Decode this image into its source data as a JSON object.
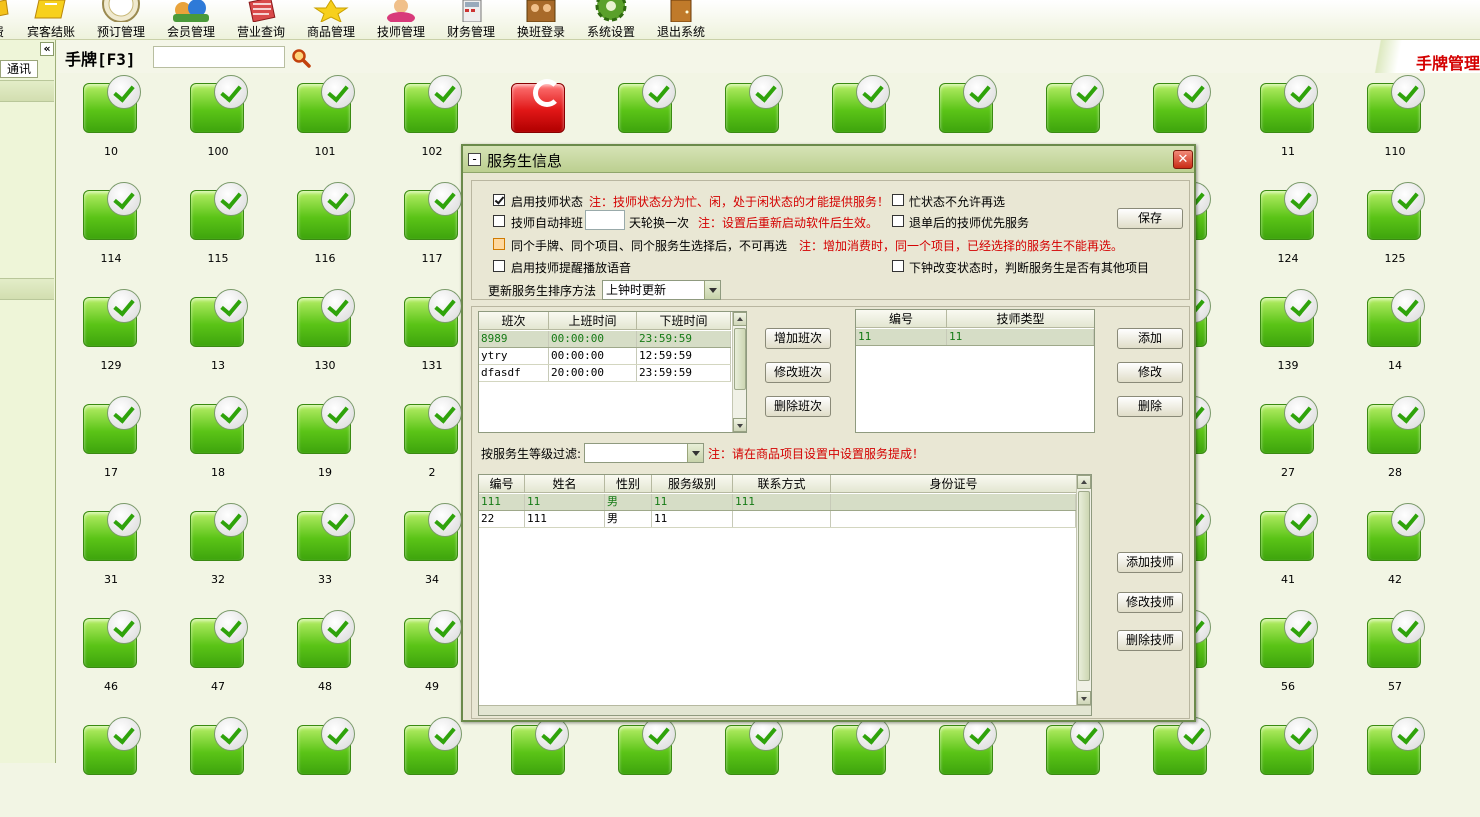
{
  "toolbar": {
    "items": [
      {
        "label": "费",
        "icon": "yellow-cut-icon"
      },
      {
        "label": "宾客结账",
        "icon": "checkout-icon"
      },
      {
        "label": "预订管理",
        "icon": "booking-clock-icon"
      },
      {
        "label": "会员管理",
        "icon": "members-icon"
      },
      {
        "label": "营业查询",
        "icon": "business-query-icon"
      },
      {
        "label": "商品管理",
        "icon": "star-goods-icon"
      },
      {
        "label": "技师管理",
        "icon": "technician-icon"
      },
      {
        "label": "财务管理",
        "icon": "finance-icon"
      },
      {
        "label": "换班登录",
        "icon": "shift-login-icon"
      },
      {
        "label": "系统设置",
        "icon": "gear-icon"
      },
      {
        "label": "退出系统",
        "icon": "exit-door-icon"
      }
    ]
  },
  "left_panel": {
    "collapse_label": "«",
    "tab_label": "通讯"
  },
  "header": {
    "title": "手牌[F3]",
    "search_value": "",
    "right_title": "手牌管理"
  },
  "tiles": [
    {
      "label": "10",
      "status": "free"
    },
    {
      "label": "100",
      "status": "free"
    },
    {
      "label": "101",
      "status": "free"
    },
    {
      "label": "102",
      "status": "free"
    },
    {
      "label": "",
      "status": "busy"
    },
    {
      "label": "",
      "status": "free"
    },
    {
      "label": "",
      "status": "free"
    },
    {
      "label": "",
      "status": "free"
    },
    {
      "label": "",
      "status": "free"
    },
    {
      "label": "",
      "status": "free"
    },
    {
      "label": "",
      "status": "free"
    },
    {
      "label": "11",
      "status": "free"
    },
    {
      "label": "110",
      "status": "free"
    },
    {
      "label": "114",
      "status": "free"
    },
    {
      "label": "115",
      "status": "free"
    },
    {
      "label": "116",
      "status": "free"
    },
    {
      "label": "117",
      "status": "free"
    },
    {
      "label": "",
      "status": "free"
    },
    {
      "label": "",
      "status": "free"
    },
    {
      "label": "",
      "status": "free"
    },
    {
      "label": "",
      "status": "free"
    },
    {
      "label": "",
      "status": "free"
    },
    {
      "label": "",
      "status": "free"
    },
    {
      "label": "",
      "status": "free"
    },
    {
      "label": "124",
      "status": "free"
    },
    {
      "label": "125",
      "status": "free"
    },
    {
      "label": "129",
      "status": "free"
    },
    {
      "label": "13",
      "status": "free"
    },
    {
      "label": "130",
      "status": "free"
    },
    {
      "label": "131",
      "status": "free"
    },
    {
      "label": "",
      "status": "free"
    },
    {
      "label": "",
      "status": "free"
    },
    {
      "label": "",
      "status": "free"
    },
    {
      "label": "",
      "status": "free"
    },
    {
      "label": "",
      "status": "free"
    },
    {
      "label": "",
      "status": "free"
    },
    {
      "label": "",
      "status": "free"
    },
    {
      "label": "139",
      "status": "free"
    },
    {
      "label": "14",
      "status": "free"
    },
    {
      "label": "17",
      "status": "free"
    },
    {
      "label": "18",
      "status": "free"
    },
    {
      "label": "19",
      "status": "free"
    },
    {
      "label": "2",
      "status": "free"
    },
    {
      "label": "",
      "status": "free"
    },
    {
      "label": "",
      "status": "free"
    },
    {
      "label": "",
      "status": "free"
    },
    {
      "label": "",
      "status": "free"
    },
    {
      "label": "",
      "status": "free"
    },
    {
      "label": "",
      "status": "free"
    },
    {
      "label": "",
      "status": "free"
    },
    {
      "label": "27",
      "status": "free"
    },
    {
      "label": "28",
      "status": "free"
    },
    {
      "label": "31",
      "status": "free"
    },
    {
      "label": "32",
      "status": "free"
    },
    {
      "label": "33",
      "status": "free"
    },
    {
      "label": "34",
      "status": "free"
    },
    {
      "label": "",
      "status": "free"
    },
    {
      "label": "",
      "status": "free"
    },
    {
      "label": "",
      "status": "free"
    },
    {
      "label": "",
      "status": "free"
    },
    {
      "label": "",
      "status": "free"
    },
    {
      "label": "",
      "status": "free"
    },
    {
      "label": "",
      "status": "free"
    },
    {
      "label": "41",
      "status": "free"
    },
    {
      "label": "42",
      "status": "free"
    },
    {
      "label": "46",
      "status": "free"
    },
    {
      "label": "47",
      "status": "free"
    },
    {
      "label": "48",
      "status": "free"
    },
    {
      "label": "49",
      "status": "free"
    },
    {
      "label": "",
      "status": "free"
    },
    {
      "label": "",
      "status": "free"
    },
    {
      "label": "",
      "status": "free"
    },
    {
      "label": "",
      "status": "free"
    },
    {
      "label": "",
      "status": "free"
    },
    {
      "label": "",
      "status": "free"
    },
    {
      "label": "",
      "status": "free"
    },
    {
      "label": "56",
      "status": "free"
    },
    {
      "label": "57",
      "status": "free"
    },
    {
      "label": "",
      "status": "free"
    },
    {
      "label": "",
      "status": "free"
    },
    {
      "label": "",
      "status": "free"
    },
    {
      "label": "",
      "status": "free"
    },
    {
      "label": "",
      "status": "free"
    },
    {
      "label": "",
      "status": "free"
    },
    {
      "label": "",
      "status": "free"
    },
    {
      "label": "",
      "status": "free"
    },
    {
      "label": "",
      "status": "free"
    },
    {
      "label": "",
      "status": "free"
    },
    {
      "label": "",
      "status": "free"
    },
    {
      "label": "",
      "status": "free"
    },
    {
      "label": "",
      "status": "free"
    }
  ],
  "dialog": {
    "title": "服务生信息",
    "close_label": "✕",
    "options": {
      "enable_status": {
        "label": "启用技师状态",
        "checked": true,
        "note": "注：技师状态分为忙、闲，处于闲状态的才能提供服务！"
      },
      "busy_no_reselect": {
        "label": "忙状态不允许再选",
        "checked": false
      },
      "auto_schedule": {
        "label": "技师自动排班",
        "checked": false,
        "days_value": "",
        "suffix": "天轮换一次",
        "note": "注：设置后重新启动软件后生效。"
      },
      "priority_after_cancel": {
        "label": "退单后的技师优先服务",
        "checked": false
      },
      "no_reselect_same": {
        "label": "同个手牌、同个项目、同个服务生选择后，不可再选",
        "checked": false,
        "note": "注：增加消费时，同一个项目，已经选择的服务生不能再选。"
      },
      "voice_reminder": {
        "label": "启用技师提醒播放语音",
        "checked": false
      },
      "check_other_items": {
        "label": "下钟改变状态时，判断服务生是否有其他项目",
        "checked": false
      }
    },
    "sort_method": {
      "label": "更新服务生排序方法",
      "value": "上钟时更新"
    },
    "save_label": "保存",
    "shift_table": {
      "columns": [
        "班次",
        "上班时间",
        "下班时间"
      ],
      "rows": [
        [
          "8989",
          "00:00:00",
          "23:59:59"
        ],
        [
          "ytry",
          "00:00:00",
          "12:59:59"
        ],
        [
          "dfasdf",
          "20:00:00",
          "23:59:59"
        ]
      ]
    },
    "shift_buttons": {
      "add": "增加班次",
      "edit": "修改班次",
      "delete": "删除班次"
    },
    "type_table": {
      "columns": [
        "编号",
        "技师类型"
      ],
      "rows": [
        [
          "11",
          "11"
        ]
      ]
    },
    "type_buttons": {
      "add": "添加",
      "edit": "修改",
      "delete": "删除"
    },
    "level_filter": {
      "label": "按服务生等级过滤:",
      "value": "",
      "note": "注：请在商品项目设置中设置服务提成！"
    },
    "staff_table": {
      "columns": [
        "编号",
        "姓名",
        "性别",
        "服务级别",
        "联系方式",
        "身份证号"
      ],
      "rows": [
        [
          "111",
          "11",
          "男",
          "11",
          "111",
          ""
        ],
        [
          "22",
          "111",
          "男",
          "11",
          "",
          ""
        ]
      ]
    },
    "staff_buttons": {
      "add": "添加技师",
      "edit": "修改技师",
      "delete": "删除技师"
    }
  }
}
